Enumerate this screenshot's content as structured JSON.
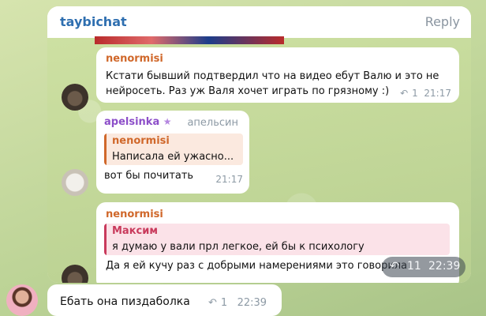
{
  "outer": {
    "title": "taybichat",
    "reply_label": "Reply"
  },
  "messages": [
    {
      "author": "nenormisi",
      "text_line1": "Кстати бывший подтвердил что на видео ебут Валю и это не",
      "text_line2": "нейросеть. Раз уж Валя хочет играть по грязному :)",
      "reply_count": "1",
      "time": "21:17"
    },
    {
      "author": "apelsinka",
      "author_badge": "★",
      "author_suffix": "апельсин",
      "quote_author": "nenormisi",
      "quote_text": "Написала ей ужасно...",
      "text": "вот бы почитать",
      "time": "21:17"
    },
    {
      "author": "nenormisi",
      "quote_author": "Максим",
      "quote_text": "я думаю у вали прл легкое, ей бы к психологу",
      "text": "Да я ей кучу раз с добрыми намерениями это говорила"
    }
  ],
  "floating_meta": {
    "reply_count": "11",
    "time": "22:39"
  },
  "bottom_message": {
    "text": "Ебать она пиздаболка",
    "reply_count": "1",
    "time": "22:39"
  },
  "colors": {
    "nenormisi": "#d0682b",
    "apelsinka": "#8d4fc9",
    "maksim": "#c93a5c",
    "title": "#2f6fb0"
  }
}
